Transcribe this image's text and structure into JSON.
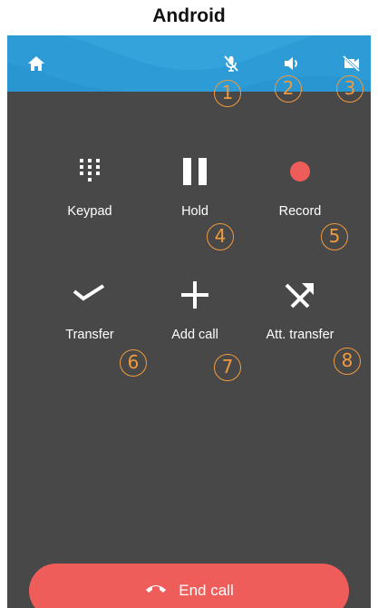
{
  "platform_label": "Android",
  "topbar": {
    "home_icon": "home-icon",
    "mic_icon": "mic-muted-icon",
    "speaker_icon": "speaker-icon",
    "video_icon": "video-off-icon",
    "background": "#2d9bd6"
  },
  "actions": {
    "keypad": {
      "label": "Keypad",
      "icon": "dialpad-icon"
    },
    "hold": {
      "label": "Hold",
      "icon": "pause-icon"
    },
    "record": {
      "label": "Record",
      "icon": "record-dot-icon",
      "color": "#ef5d5a"
    },
    "transfer": {
      "label": "Transfer",
      "icon": "transfer-check-icon"
    },
    "add_call": {
      "label": "Add call",
      "icon": "plus-icon"
    },
    "att_transfer": {
      "label": "Att. transfer",
      "icon": "attended-transfer-icon"
    }
  },
  "end_call": {
    "label": "End call",
    "icon": "hang-up-icon",
    "color": "#ef5d5a"
  },
  "annotations": [
    "1",
    "2",
    "3",
    "4",
    "5",
    "6",
    "7",
    "8"
  ],
  "colors": {
    "screen_bg": "#484848",
    "annotation": "#f09a3e"
  }
}
